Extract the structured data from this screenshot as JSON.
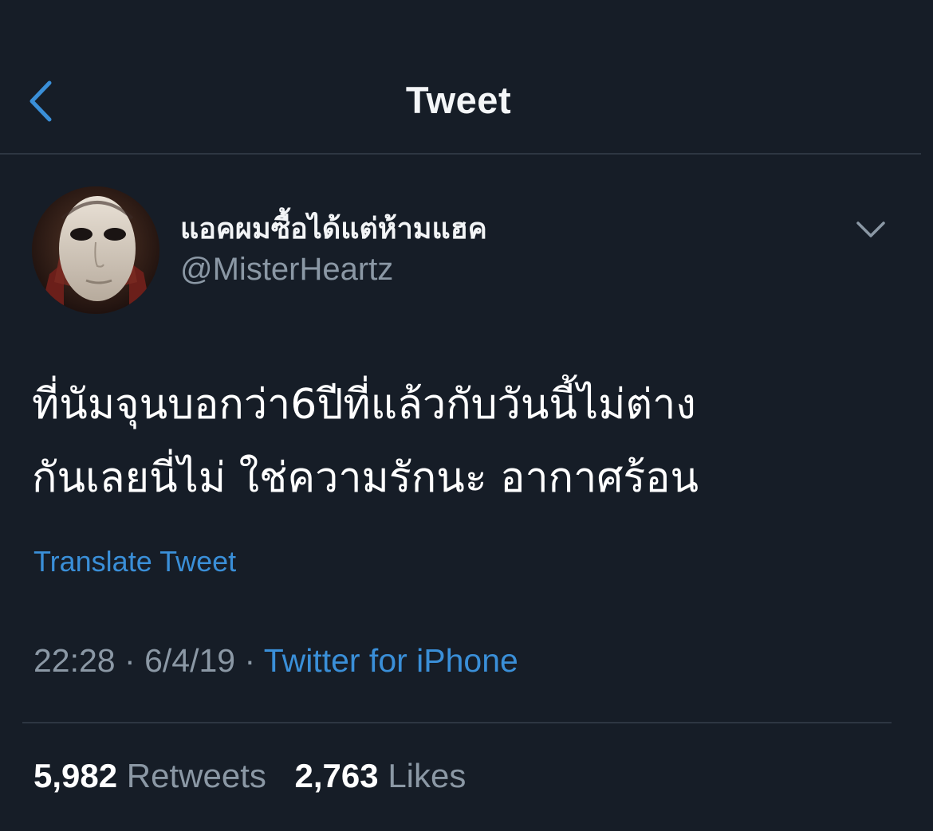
{
  "header": {
    "title": "Tweet",
    "back_icon": "chevron-left-icon"
  },
  "author": {
    "display_name": "แอคผมซื้อได้แต่ห้ามแฮค",
    "handle": "@MisterHeartz",
    "menu_icon": "chevron-down-icon"
  },
  "tweet": {
    "lines": [
      "ที่นัมจุนบอกว่า6ปีที่แล้วกับวันนี้ไม่ต่าง",
      "กันเลยนี่ไม่ ใช่ความรักนะ อากาศร้อน"
    ],
    "translate_label": "Translate Tweet",
    "time": "22:28",
    "date": "6/4/19",
    "separator": "·",
    "source": "Twitter for iPhone"
  },
  "stats": {
    "retweets_count": "5,982",
    "retweets_label": "Retweets",
    "likes_count": "2,763",
    "likes_label": "Likes"
  },
  "colors": {
    "background": "#161d27",
    "accent": "#3a8fd8",
    "secondary_text": "#8b98a5",
    "divider": "#2d3642"
  }
}
